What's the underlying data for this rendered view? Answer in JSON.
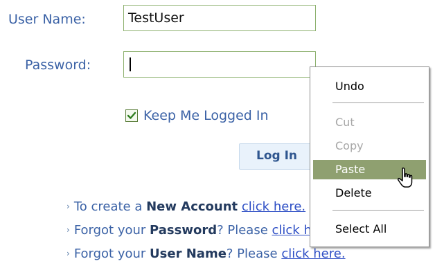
{
  "form": {
    "username_label": "User Name:",
    "username_value": "TestUser",
    "password_label": "Password:",
    "password_value": "",
    "keep_logged_in_label": "Keep Me Logged In",
    "keep_logged_in_checked": true,
    "login_button_label": "Log In"
  },
  "help_links": [
    {
      "prefix": "To create a ",
      "bold": "New Account",
      "middle": " ",
      "link": "click here."
    },
    {
      "prefix": "Forgot your ",
      "bold": "Password",
      "middle": "? Please ",
      "link": "click here."
    },
    {
      "prefix": "Forgot your ",
      "bold": "User Name",
      "middle": "? Please ",
      "link": "click here."
    }
  ],
  "context_menu": {
    "items": [
      {
        "label": "Undo",
        "state": "enabled"
      },
      {
        "label": "Cut",
        "state": "disabled"
      },
      {
        "label": "Copy",
        "state": "disabled"
      },
      {
        "label": "Paste",
        "state": "highlighted"
      },
      {
        "label": "Delete",
        "state": "enabled"
      },
      {
        "label": "Select All",
        "state": "enabled"
      }
    ]
  },
  "icons": {
    "checkbox": "checkmark-icon",
    "bullet": "small-chevron-right-icon",
    "cursor": "mouse-pointer-icon"
  },
  "colors": {
    "label_text": "#3b62a6",
    "input_border": "#8cb06d",
    "menu_highlight": "#8fa070",
    "link": "#2e4fc5"
  }
}
